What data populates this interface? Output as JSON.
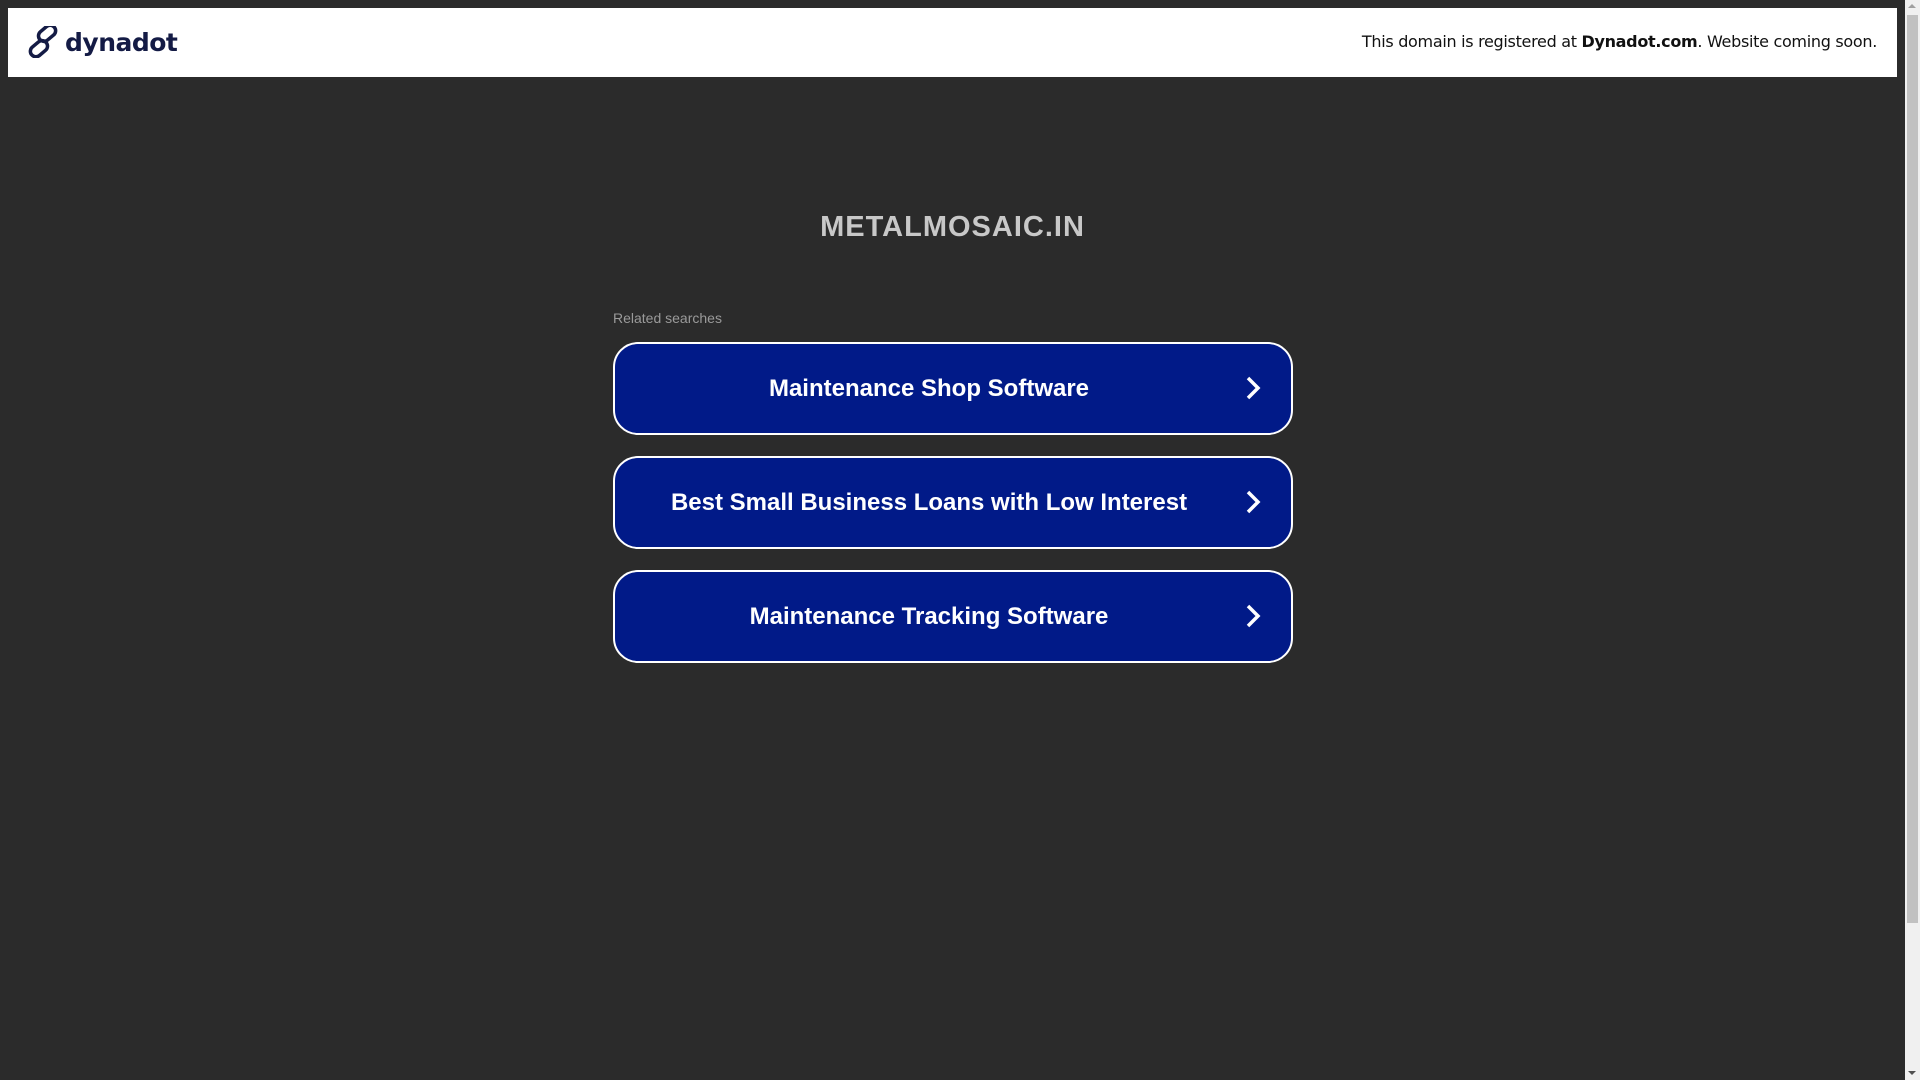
{
  "header": {
    "logo_text": "dynadot",
    "notice_prefix": "This domain is registered at ",
    "notice_brand": "Dynadot.com",
    "notice_suffix": ". Website coming soon."
  },
  "main": {
    "domain_title": "METALMOSAIC.IN",
    "related_label": "Related searches",
    "searches": [
      {
        "label": "Maintenance Shop Software"
      },
      {
        "label": "Best Small Business Loans with Low Interest"
      },
      {
        "label": "Maintenance Tracking Software"
      }
    ]
  },
  "colors": {
    "button_bg": "#011a88",
    "background": "#2b2b2b",
    "logo": "#141b45"
  }
}
